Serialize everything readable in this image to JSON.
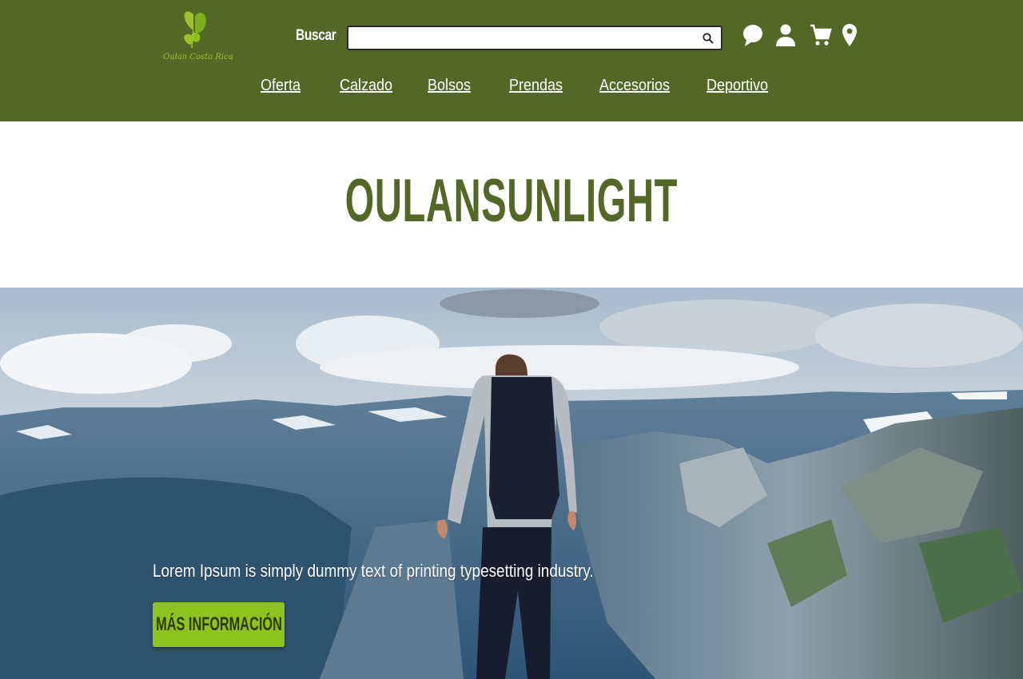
{
  "header": {
    "logo_text": "Oulan Costa Rica",
    "search_label": "Buscar",
    "search_value": "",
    "search_placeholder": "",
    "icons": [
      "search-icon",
      "chat-icon",
      "user-icon",
      "cart-icon",
      "location-icon"
    ]
  },
  "nav": {
    "items": [
      {
        "label": "Oferta"
      },
      {
        "label": "Calzado"
      },
      {
        "label": "Bolsos"
      },
      {
        "label": "Prendas"
      },
      {
        "label": "Accesorios"
      },
      {
        "label": "Deportivo"
      }
    ]
  },
  "main": {
    "title": "OULANSUNLIGHT"
  },
  "hero": {
    "text": "Lorem Ipsum is simply dummy text of printing typesetting industry.",
    "button_label": "MÁS INFORMACIÓN"
  },
  "colors": {
    "header_bg": "#536827",
    "title": "#536827",
    "button_bg": "#8dc21f",
    "logo": "#9cc22e"
  }
}
